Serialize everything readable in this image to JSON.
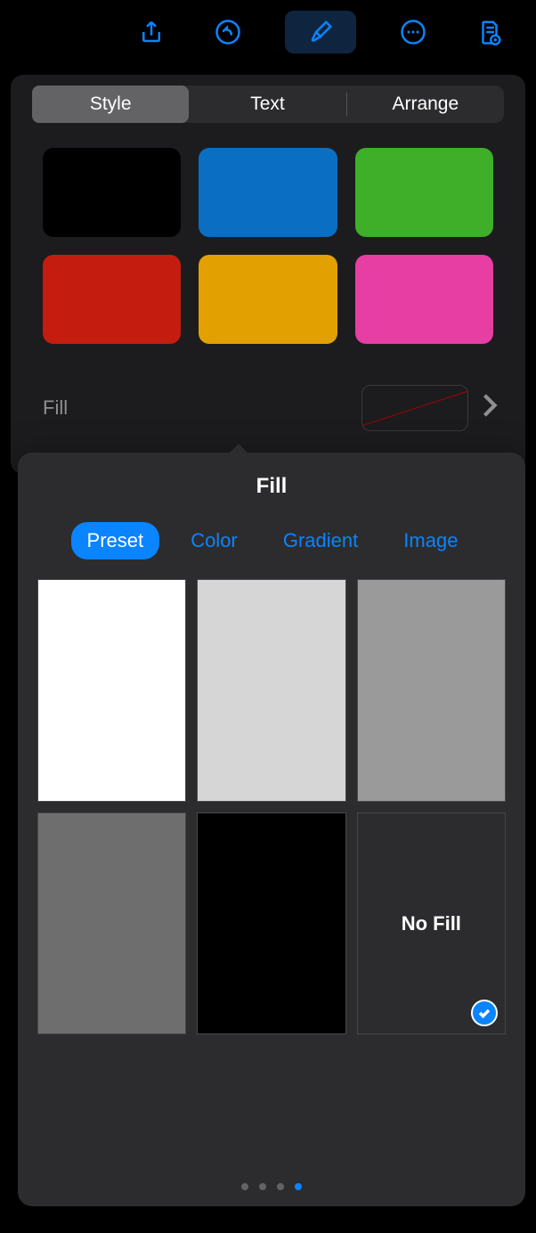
{
  "toolbar": {
    "icons": [
      "share",
      "undo",
      "format",
      "more",
      "document-options"
    ],
    "active_index": 2
  },
  "segmented": {
    "items": [
      "Style",
      "Text",
      "Arrange"
    ],
    "selected_index": 0
  },
  "style_swatches": [
    {
      "color": "#000000"
    },
    {
      "color": "#0a6fc2"
    },
    {
      "color": "#3fae29"
    },
    {
      "color": "#c41d10"
    },
    {
      "color": "#e2a100"
    },
    {
      "color": "#e63ea3"
    }
  ],
  "fill_row": {
    "label": "Fill",
    "current": "none"
  },
  "popover": {
    "title": "Fill",
    "tabs": [
      "Preset",
      "Color",
      "Gradient",
      "Image"
    ],
    "selected_tab_index": 0,
    "presets": [
      {
        "bg": "#ffffff"
      },
      {
        "bg": "#d6d6d6"
      },
      {
        "bg": "#9a9a9a"
      },
      {
        "bg": "#6e6e6e"
      },
      {
        "bg": "#000000"
      },
      {
        "bg": "#2c2c2e",
        "label": "No Fill",
        "selected": true
      }
    ],
    "page_dots": {
      "count": 4,
      "active_index": 3
    }
  }
}
